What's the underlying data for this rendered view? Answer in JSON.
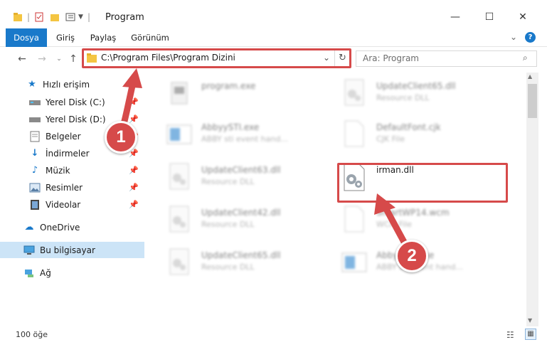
{
  "window": {
    "title": "Program",
    "minimize_icon": "minimize-icon",
    "maximize_icon": "maximize-icon",
    "close_icon": "close-icon"
  },
  "ribbon": {
    "tabs": [
      "Dosya",
      "Giriş",
      "Paylaş",
      "Görünüm"
    ],
    "accent": "#1979ca"
  },
  "nav": {
    "address": "C:\\Program Files\\Program Dizini",
    "search_placeholder": "Ara: Program"
  },
  "sidebar": {
    "quick_access": "Hızlı erişim",
    "items": [
      {
        "label": "Yerel Disk (C:)",
        "icon": "drive-icon"
      },
      {
        "label": "Yerel Disk (D:)",
        "icon": "drive-icon"
      },
      {
        "label": "Belgeler",
        "icon": "documents-icon"
      },
      {
        "label": "İndirmeler",
        "icon": "download-icon"
      },
      {
        "label": "Müzik",
        "icon": "music-icon"
      },
      {
        "label": "Resimler",
        "icon": "pictures-icon"
      },
      {
        "label": "Videolar",
        "icon": "videos-icon"
      }
    ],
    "onedrive": "OneDrive",
    "this_pc": "Bu bilgisayar",
    "network": "Ağ"
  },
  "files": {
    "left": [
      {
        "name": "program.exe",
        "desc": ""
      },
      {
        "name": "AbbyySTI.exe",
        "desc": "ABBY sti event hand..."
      },
      {
        "name": "UpdateClient63.dll",
        "desc": "Resource DLL"
      },
      {
        "name": "UpdateClient42.dll",
        "desc": "Resource DLL"
      },
      {
        "name": "UpdateClient65.dll",
        "desc": "Resource DLL"
      }
    ],
    "right": [
      {
        "name": "UpdateClient65.dll",
        "desc": "Resource DLL"
      },
      {
        "name": "DefaultFont.cjk",
        "desc": "CJK File"
      },
      {
        "name": "irman.dll",
        "desc": ""
      },
      {
        "name": "SmartWP14.wcm",
        "desc": "WCM File"
      },
      {
        "name": "AbbyySTI.exe",
        "desc": "ABBY sti event hand..."
      }
    ]
  },
  "status": {
    "count": "100 öğe"
  },
  "annotations": {
    "step1": "1",
    "step2": "2",
    "color": "#d64a4a"
  }
}
